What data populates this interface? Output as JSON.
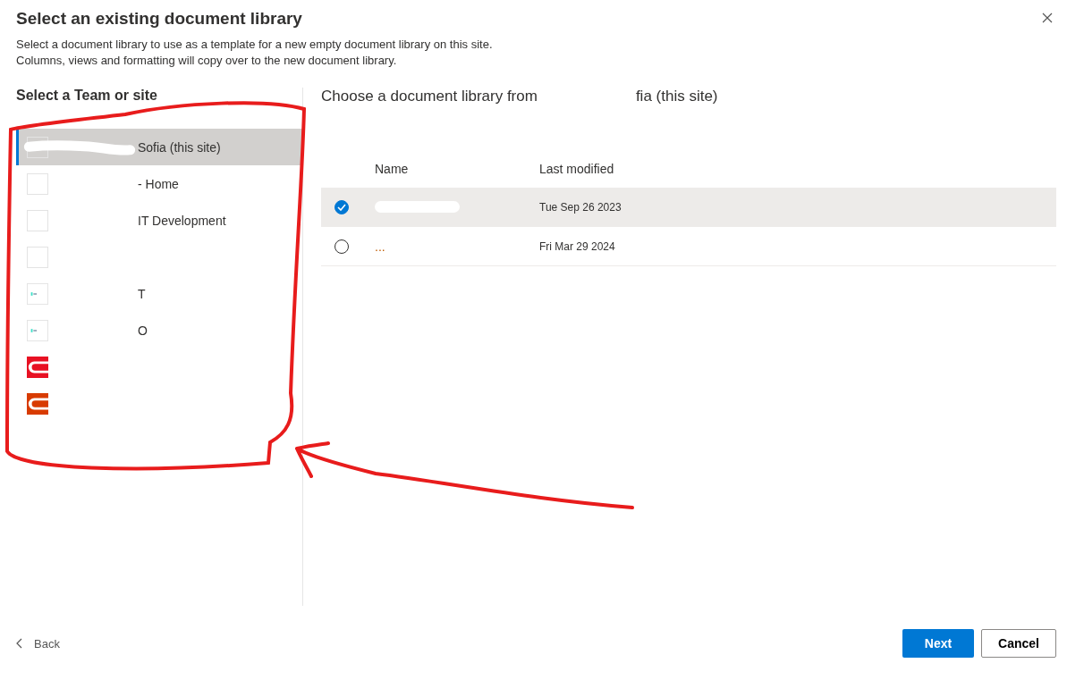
{
  "dialog": {
    "title": "Select an existing document library",
    "description": [
      "Select a document library to use as a template for a new empty document library on this site.",
      "Columns, views and formatting will copy over to the new document library."
    ]
  },
  "sites": {
    "heading": "Select a Team or site",
    "items": [
      {
        "label": "Sofia (this site)",
        "kind": "blank",
        "selected": true,
        "redacted": true
      },
      {
        "label": "- Home",
        "kind": "blank",
        "selected": false,
        "redacted": false
      },
      {
        "label": "IT Development",
        "kind": "blank",
        "selected": false,
        "redacted": false
      },
      {
        "kind": "blank",
        "selected": false
      },
      {
        "label": "T",
        "kind": "teal",
        "selected": false,
        "redacted": false
      },
      {
        "label": "O",
        "kind": "teal",
        "selected": false,
        "redacted": false
      },
      {
        "kind": "red",
        "selected": false
      },
      {
        "kind": "orange",
        "selected": false
      }
    ]
  },
  "libraries": {
    "heading": "Choose a document library from",
    "heading_tail": "fia (this site)",
    "columns": [
      "Name",
      "Last modified"
    ],
    "rows": [
      {
        "redacted": true,
        "modified": "Tue Sep 26 2023",
        "selected": true
      },
      {
        "name": "...",
        "redacted": false,
        "modified": "Fri Mar 29 2024",
        "selected": false
      }
    ]
  },
  "footer": {
    "back": "Back",
    "next": "Next",
    "cancel": "Cancel"
  }
}
